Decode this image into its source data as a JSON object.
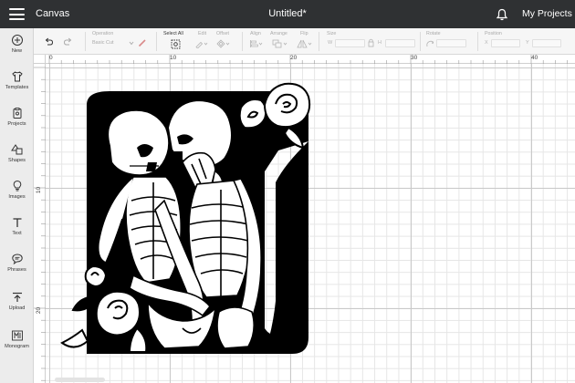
{
  "topbar": {
    "app_title": "Canvas",
    "doc_title": "Untitled*",
    "my_projects": "My Projects"
  },
  "rail": {
    "items": [
      {
        "label": "New",
        "icon": "plus-circle-icon"
      },
      {
        "label": "Templates",
        "icon": "shirt-icon"
      },
      {
        "label": "Projects",
        "icon": "clipboard-icon"
      },
      {
        "label": "Shapes",
        "icon": "shapes-icon"
      },
      {
        "label": "Images",
        "icon": "lightbulb-icon"
      },
      {
        "label": "Text",
        "icon": "text-icon"
      },
      {
        "label": "Phrases",
        "icon": "speech-bubble-icon"
      },
      {
        "label": "Upload",
        "icon": "upload-icon"
      },
      {
        "label": "Monogram",
        "icon": "monogram-icon"
      }
    ]
  },
  "toolbar": {
    "operation_label": "Operation",
    "operation_value": "Basic Cut",
    "select_all_label": "Select All",
    "edit_label": "Edit",
    "offset_label": "Offset",
    "align_label": "Align",
    "arrange_label": "Arrange",
    "flip_label": "Flip",
    "size_label": "Size",
    "size_w": "W",
    "size_h": "H",
    "rotate_label": "Rotate",
    "position_label": "Position",
    "position_x": "X",
    "position_y": "Y"
  },
  "rulers": {
    "top": [
      "0",
      "10",
      "20",
      "30",
      "40"
    ],
    "left": [
      "10",
      "20"
    ]
  },
  "colors": {
    "topbar_bg": "#2f3133",
    "rail_bg": "#ececec",
    "artwork": "#000000"
  }
}
